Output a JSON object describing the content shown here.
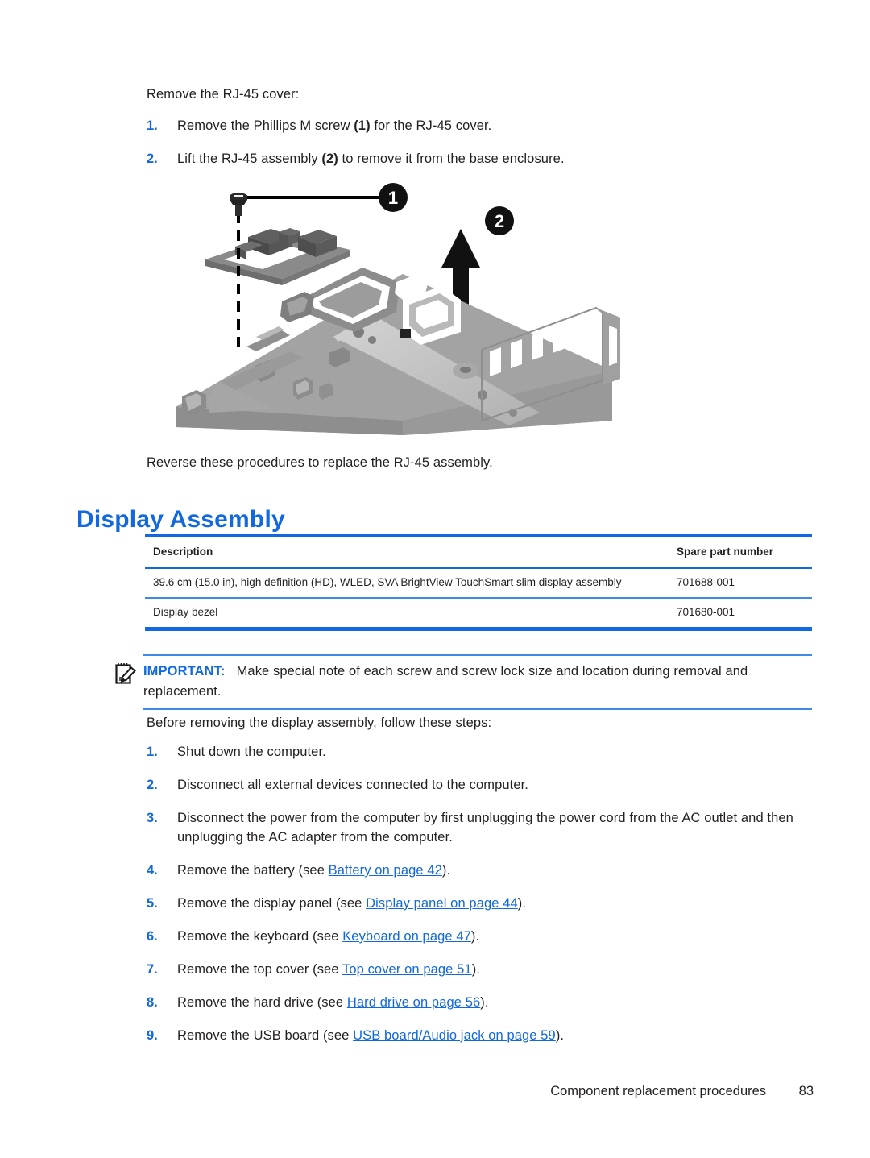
{
  "intro": {
    "lead": "Remove the RJ-45 cover:"
  },
  "rj45_steps": [
    {
      "num": "1.",
      "parts": [
        {
          "t": "Remove the Phillips M screw ",
          "bold": false
        },
        {
          "t": "(1)",
          "bold": true
        },
        {
          "t": " for the RJ-45 cover.",
          "bold": false
        }
      ]
    },
    {
      "num": "2.",
      "parts": [
        {
          "t": "Lift the RJ-45 assembly ",
          "bold": false
        },
        {
          "t": "(2)",
          "bold": true
        },
        {
          "t": " to remove it from the base enclosure.",
          "bold": false
        }
      ]
    }
  ],
  "illustration": {
    "alt": "Exploded view of laptop base enclosure with RJ-45 cover removal",
    "callouts": [
      "1",
      "2"
    ],
    "colors": {
      "callout_fill": "#111111",
      "callout_text": "#ffffff",
      "chassis_dark": "#7a7a7a",
      "chassis_mid": "#9b9b9b",
      "chassis_light": "#bdbdbd",
      "chassis_pale": "#d6d6d6"
    }
  },
  "reverse_note": "Reverse these procedures to replace the RJ-45 assembly.",
  "heading": "Display Assembly",
  "table": {
    "columns": [
      "Description",
      "Spare part number"
    ],
    "rows": [
      {
        "description": "39.6 cm (15.0 in), high definition (HD), WLED, SVA BrightView TouchSmart slim display assembly",
        "part": "701688-001"
      },
      {
        "description": "Display bezel",
        "part": "701680-001"
      }
    ]
  },
  "important": {
    "icon": "note-pencil-icon",
    "label": "IMPORTANT:",
    "text": "Make special note of each screw and screw lock size and location during removal and replacement."
  },
  "before": {
    "lead": "Before removing the display assembly, follow these steps:"
  },
  "display_steps": [
    {
      "num": "1.",
      "before": "Shut down the computer.",
      "link": "",
      "after": ""
    },
    {
      "num": "2.",
      "before": "Disconnect all external devices connected to the computer.",
      "link": "",
      "after": ""
    },
    {
      "num": "3.",
      "before": "Disconnect the power from the computer by first unplugging the power cord from the AC outlet and then unplugging the AC adapter from the computer.",
      "link": "",
      "after": ""
    },
    {
      "num": "4.",
      "before": "Remove the battery (see ",
      "link": "Battery on page 42",
      "after": ")."
    },
    {
      "num": "5.",
      "before": "Remove the display panel (see ",
      "link": "Display panel on page 44",
      "after": ")."
    },
    {
      "num": "6.",
      "before": "Remove the keyboard (see ",
      "link": "Keyboard on page 47",
      "after": ")."
    },
    {
      "num": "7.",
      "before": "Remove the top cover (see ",
      "link": "Top cover on page 51",
      "after": ")."
    },
    {
      "num": "8.",
      "before": "Remove the hard drive (see ",
      "link": "Hard drive on page 56",
      "after": ")."
    },
    {
      "num": "9.",
      "before": "Remove the USB board (see ",
      "link": "USB board/Audio jack on page 59",
      "after": ")."
    }
  ],
  "footer": {
    "title": "Component replacement procedures",
    "page": "83"
  },
  "colors": {
    "accent_blue": "#1168e0",
    "rule_blue": "#3f8ae8",
    "text": "#231f20"
  }
}
